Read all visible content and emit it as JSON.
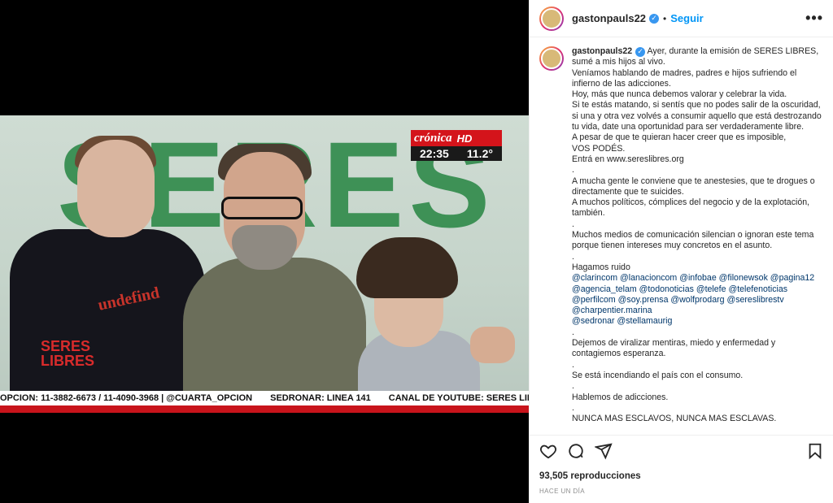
{
  "post": {
    "username": "gastonpauls22",
    "verified_icon": "✓",
    "separator": "•",
    "follow_label": "Seguir",
    "more_icon": "•••",
    "caption_lines": [
      {
        "text": "Ayer, durante la emisión de SERES LIBRES,"
      },
      {
        "text": "sumé a mis hijos al vivo."
      },
      {
        "text": "Veníamos hablando de madres, padres e hijos sufriendo el"
      },
      {
        "text": "infierno de las adicciones."
      },
      {
        "text": "Hoy, más que nunca debemos valorar y celebrar la vida."
      },
      {
        "text": "Si te estás matando, si sentís que no podes salir de la oscuridad,"
      },
      {
        "text": "si una y otra vez volvés a consumir aquello que está destrozando"
      },
      {
        "text": "tu vida, date una oportunidad para ser verdaderamente libre."
      },
      {
        "text": "A pesar de que te quieran hacer creer que es imposible,"
      },
      {
        "text": "VOS PODÉS."
      },
      {
        "text": "Entrá en www.sereslibres.org"
      },
      {
        "text": "."
      },
      {
        "text": "A mucha gente le conviene que te anestesies, que te drogues o"
      },
      {
        "text": "directamente que te suicides."
      },
      {
        "text": "A muchos políticos, cómplices del negocio y de la explotación,"
      },
      {
        "text": "también."
      },
      {
        "text": "."
      },
      {
        "text": "Muchos medios de comunicación silencian o ignoran este tema"
      },
      {
        "text": "porque tienen intereses muy concretos en el asunto."
      },
      {
        "text": "."
      },
      {
        "text": "Hagamos ruido"
      },
      {
        "text": "@clarincom @lanacioncom @infobae @filonewsok @pagina12",
        "mention": true
      },
      {
        "text": "@agencia_telam @todonoticias @telefe @telefenoticias",
        "mention": true
      },
      {
        "text": "@perfilcom @soy.prensa @wolfprodarg @sereslibrestv",
        "mention": true
      },
      {
        "text": "@charpentier.marina",
        "mention": true
      },
      {
        "text": "@sedronar @stellamaurig",
        "mention": true
      },
      {
        "text": "."
      },
      {
        "text": "Dejemos de viralizar mentiras, miedo y enfermedad y"
      },
      {
        "text": "contagiemos esperanza."
      },
      {
        "text": "."
      },
      {
        "text": "Se está incendiando el país con el consumo."
      },
      {
        "text": "."
      },
      {
        "text": "Hablemos de adicciones."
      },
      {
        "text": "."
      },
      {
        "text": "NUNCA MAS ESCLAVOS, NUNCA MAS ESCLAVAS."
      }
    ],
    "views": "93,505 reproducciones",
    "time": "HACE UN DÍA"
  },
  "video": {
    "channel_name": "crónica",
    "channel_hd": "HD",
    "clock": "22:35",
    "temperature": "11.2°",
    "background_text": "SERES",
    "hoodie_text": "undefind",
    "hoodie_logo_line1": "SERES",
    "hoodie_logo_line2": "LIBRES",
    "ticker": [
      "OPCION: 11-3882-6673 / 11-4090-3968 | @CUARTA_OPCION",
      "SEDRONAR: LINEA 141",
      "CANAL DE YOUTUBE: SERES LIBRES"
    ]
  },
  "colors": {
    "accent_blue": "#0095f6",
    "mention_blue": "#00376b",
    "cronica_red": "#d4141b",
    "seres_green": "#2f8a4a"
  },
  "icons": {
    "like": "heart-icon",
    "comment": "comment-icon",
    "share": "share-icon",
    "save": "bookmark-icon"
  }
}
